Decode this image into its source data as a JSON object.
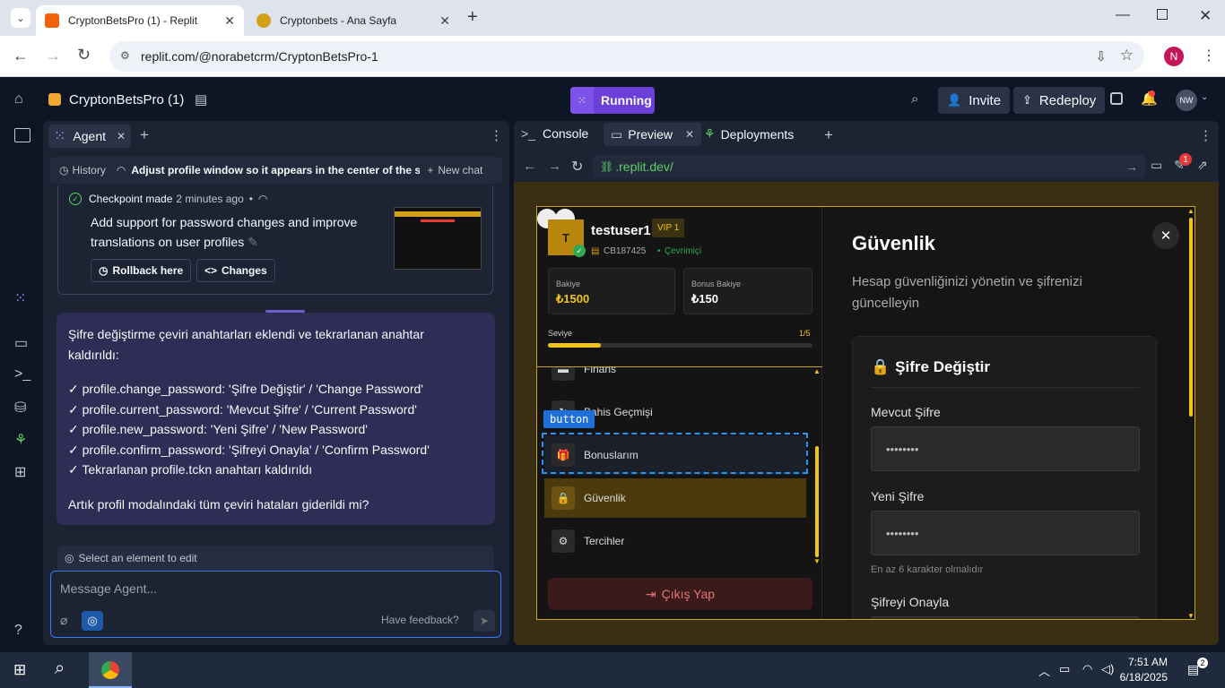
{
  "browser": {
    "tabs": [
      {
        "title": "CryptonBetsPro (1) - Replit",
        "active": true
      },
      {
        "title": "Cryptonbets - Ana Sayfa",
        "active": false
      }
    ],
    "url": "replit.com/@norabetcrm/CryptonBetsPro-1",
    "profile_initial": "N"
  },
  "replit": {
    "project_name": "CryptonBetsPro (1)",
    "run_status": "Running",
    "invite_label": "Invite",
    "redeploy_label": "Redeploy",
    "avatar_initials": "NW"
  },
  "agent": {
    "tab_label": "Agent",
    "history_label": "History",
    "chat_title": "Adjust profile window so it appears in the center of the s...",
    "new_chat_label": "New chat",
    "checkpoint_text": "Checkpoint made",
    "checkpoint_time": "2 minutes ago",
    "checkpoint_desc_1": "Add support for password changes and improve",
    "checkpoint_desc_2": "translations on user profiles",
    "rollback_label": "Rollback here",
    "changes_label": "Changes",
    "message_lines": [
      "Şifre değiştirme çeviri anahtarları eklendi ve tekrarlanan anahtar",
      "kaldırıldı:",
      "",
      "✓ profile.change_password: 'Şifre Değiştir' / 'Change Password'",
      "✓ profile.current_password: 'Mevcut Şifre' / 'Current Password'",
      "✓ profile.new_password: 'Yeni Şifre' / 'New Password'",
      "✓ profile.confirm_password: 'Şifreyi Onayla' / 'Confirm Password'",
      "✓ Tekrarlanan profile.tckn anahtarı kaldırıldı",
      "",
      "Artık profil modalındaki tüm çeviri hataları giderildi mi?"
    ],
    "select_element_label": "Select an element to edit",
    "input_placeholder": "Message Agent...",
    "feedback_label": "Have feedback?"
  },
  "preview_pane": {
    "tabs": [
      "Console",
      "Preview",
      "Deployments"
    ],
    "url": ".replit.dev/",
    "notification_count": "1"
  },
  "app": {
    "username": "testuser1",
    "vip": "VIP 1",
    "avatar_letter": "T",
    "user_id": "CB187425",
    "online_status": "Çevrimiçi",
    "balance_label": "Bakiye",
    "balance_value": "₺1500",
    "bonus_balance_label": "Bonus Bakiye",
    "bonus_balance_value": "₺150",
    "level_label": "Seviye",
    "level_value": "1/5",
    "level_progress": 0.2,
    "menu": [
      "Finans",
      "Bahis Geçmişi",
      "Bonuslarım",
      "Güvenlik",
      "Tercihler"
    ],
    "inspector_tag": "button",
    "logout_label": "Çıkış Yap",
    "security_title": "Güvenlik",
    "security_desc_1": "Hesap güvenliğinizi yönetin ve şifrenizi",
    "security_desc_2": "güncelleyin",
    "change_password_title": "Şifre Değiştir",
    "current_password_label": "Mevcut Şifre",
    "new_password_label": "Yeni Şifre",
    "confirm_password_label": "Şifreyi Onayla",
    "password_mask": "••••••••",
    "password_hint": "En az 6 karakter olmalıdır"
  },
  "taskbar": {
    "time": "7:51 AM",
    "date": "6/18/2025",
    "notifications": "2"
  }
}
